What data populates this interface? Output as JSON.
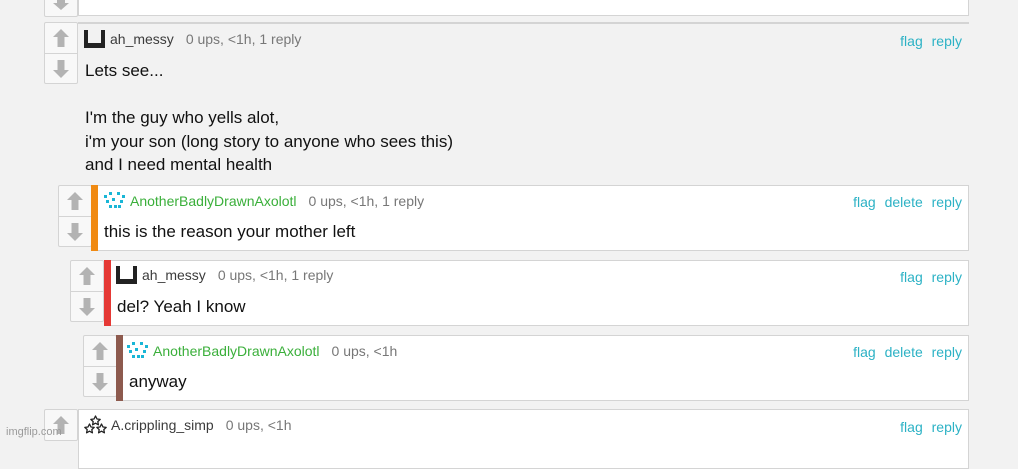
{
  "actions": {
    "flag": "flag",
    "delete": "delete",
    "reply": "reply"
  },
  "comments": [
    {
      "user": "ah_messy",
      "meta": "0 ups, <1h, 1 reply",
      "lines": [
        "Lets see...",
        "",
        "I'm the guy who yells alot,",
        "i'm your son (long story to anyone who sees this)",
        "and I need mental health"
      ]
    },
    {
      "user": "AnotherBadlyDrawnAxolotl",
      "meta": "0 ups, <1h, 1 reply",
      "lines": [
        "this is the reason your mother left"
      ],
      "bar_color": "#f08a12"
    },
    {
      "user": "ah_messy",
      "meta": "0 ups, <1h, 1 reply",
      "lines": [
        "del? Yeah I know"
      ],
      "bar_color": "#e53935"
    },
    {
      "user": "AnotherBadlyDrawnAxolotl",
      "meta": "0 ups, <1h",
      "lines": [
        "anyway"
      ],
      "bar_color": "#8d5a4e"
    },
    {
      "user": "A.crippling_simp",
      "meta": "0 ups, <1h",
      "lines": []
    }
  ],
  "colors": {
    "link": "#2cb2c5",
    "username_green": "#3aaf3a",
    "arrow": "#b3b3b3"
  },
  "watermark": "imgflip.com"
}
